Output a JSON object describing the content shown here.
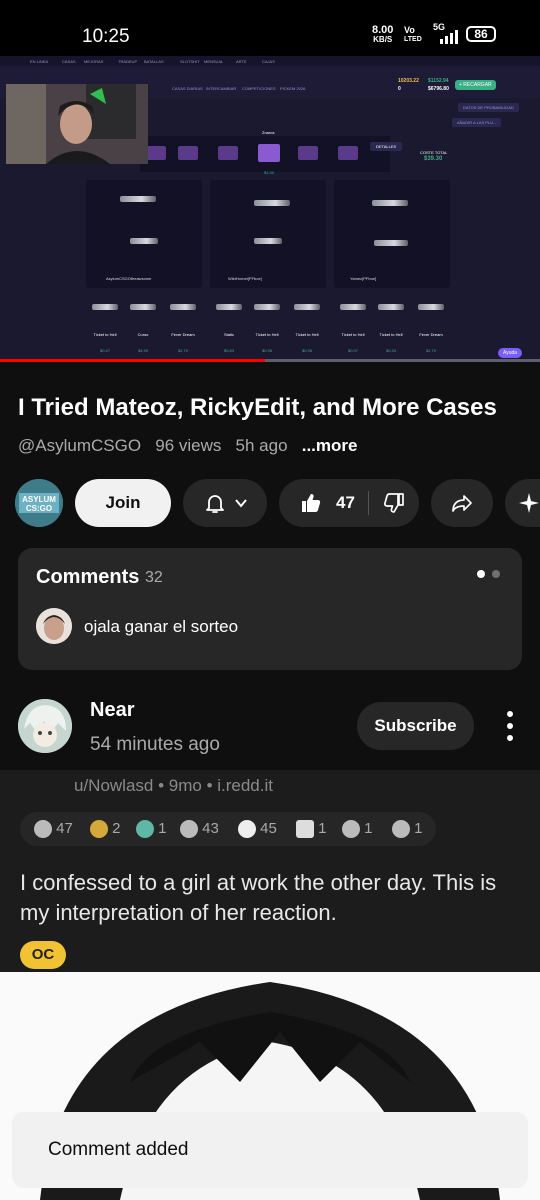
{
  "status_bar": {
    "time": "10:25",
    "speed_value": "8.00",
    "speed_unit": "KB/S",
    "volte_top": "Vo",
    "volte_bottom": "LTED",
    "network": "5G",
    "battery": "86"
  },
  "video_frame": {
    "site_balance": "10203.22",
    "site_zero": "0",
    "site_balance2": "$1152.94",
    "site_balance3": "$6796.80",
    "recargar": "+ RECARGAR",
    "nav_items": [
      "CASAS DIARIAS",
      "INTERCAMBIAR",
      "COMPETICIONES",
      "PICKEM 2026"
    ],
    "top_links": [
      "EN LINEA",
      "CASAS",
      "MEJORAS",
      "TRADEUP",
      "BATALLAS",
      "SLOTSHIT",
      "MENSUAL",
      "ARTE",
      "CAJAS"
    ],
    "case_name": "Znarca",
    "case_price": "$3.30",
    "detalles": "DETALLES",
    "cost_label": "COSTE TOTAL",
    "cost_value": "$39.30",
    "datos": "DATOS DE PROBABILIDAD",
    "anadir": "AÑADIR A LAS PLU...",
    "players": [
      "AsylumCSGOtheawsome",
      "WildHornet[PFboe]",
      "Yamez[PFboe]"
    ],
    "item_rows": [
      [
        {
          "name": "Ticket to Hell",
          "val": "$0.47"
        },
        {
          "name": "Curso",
          "val": "$4.99"
        },
        {
          "name": "Fever Dream",
          "val": "$2.79"
        }
      ],
      [
        {
          "name": "Static",
          "val": "$0.83"
        },
        {
          "name": "Ticket to Hell",
          "val": "$0.96"
        },
        {
          "name": "Ticket to Hell",
          "val": "$0.96"
        }
      ],
      [
        {
          "name": "Ticket to Hell",
          "val": "$0.07"
        },
        {
          "name": "Ticket to Hell",
          "val": "$0.33"
        },
        {
          "name": "Fever Dream",
          "val": "$2.79"
        }
      ]
    ],
    "ayuda": "Ayuda",
    "progress": 0.49
  },
  "video": {
    "title": "I Tried Mateoz, RickyEdit, and More Cases",
    "channel_handle": "@AsylumCSGO",
    "views": "96 views",
    "age": "5h ago",
    "more": "...more",
    "channel_avatar_text": "ASYLUM CS:GO"
  },
  "actions": {
    "join": "Join",
    "likes": "47"
  },
  "comments": {
    "heading": "Comments",
    "count": "32",
    "top_comment": "ojala ganar el sorteo"
  },
  "next_post": {
    "author": "Near",
    "time": "54 minutes ago",
    "subscribe": "Subscribe",
    "source": "u/Nowlasd • 9mo • i.redd.it",
    "awards": [
      {
        "icon": "silver-award-icon",
        "count": "47"
      },
      {
        "icon": "helpful-award-icon",
        "count": "2"
      },
      {
        "icon": "wholesome-award-icon",
        "count": "1"
      },
      {
        "icon": "facepalm-award-icon",
        "count": "43"
      },
      {
        "icon": "laugh-award-icon",
        "count": "45"
      },
      {
        "icon": "press-f-award-icon",
        "count": "1"
      },
      {
        "icon": "cake-award-icon",
        "count": "1"
      },
      {
        "icon": "bunny-award-icon",
        "count": "1"
      }
    ],
    "headline": "I confessed to a girl at work the other day. This is my interpretation of her reaction.",
    "flair": "OC"
  },
  "toast": {
    "message": "Comment added"
  },
  "colors": {
    "background": "#0f0f0f",
    "chip": "#272727",
    "join_bg": "#f1f1f1",
    "progress": "#ff0000",
    "flair": "#f1c232"
  }
}
